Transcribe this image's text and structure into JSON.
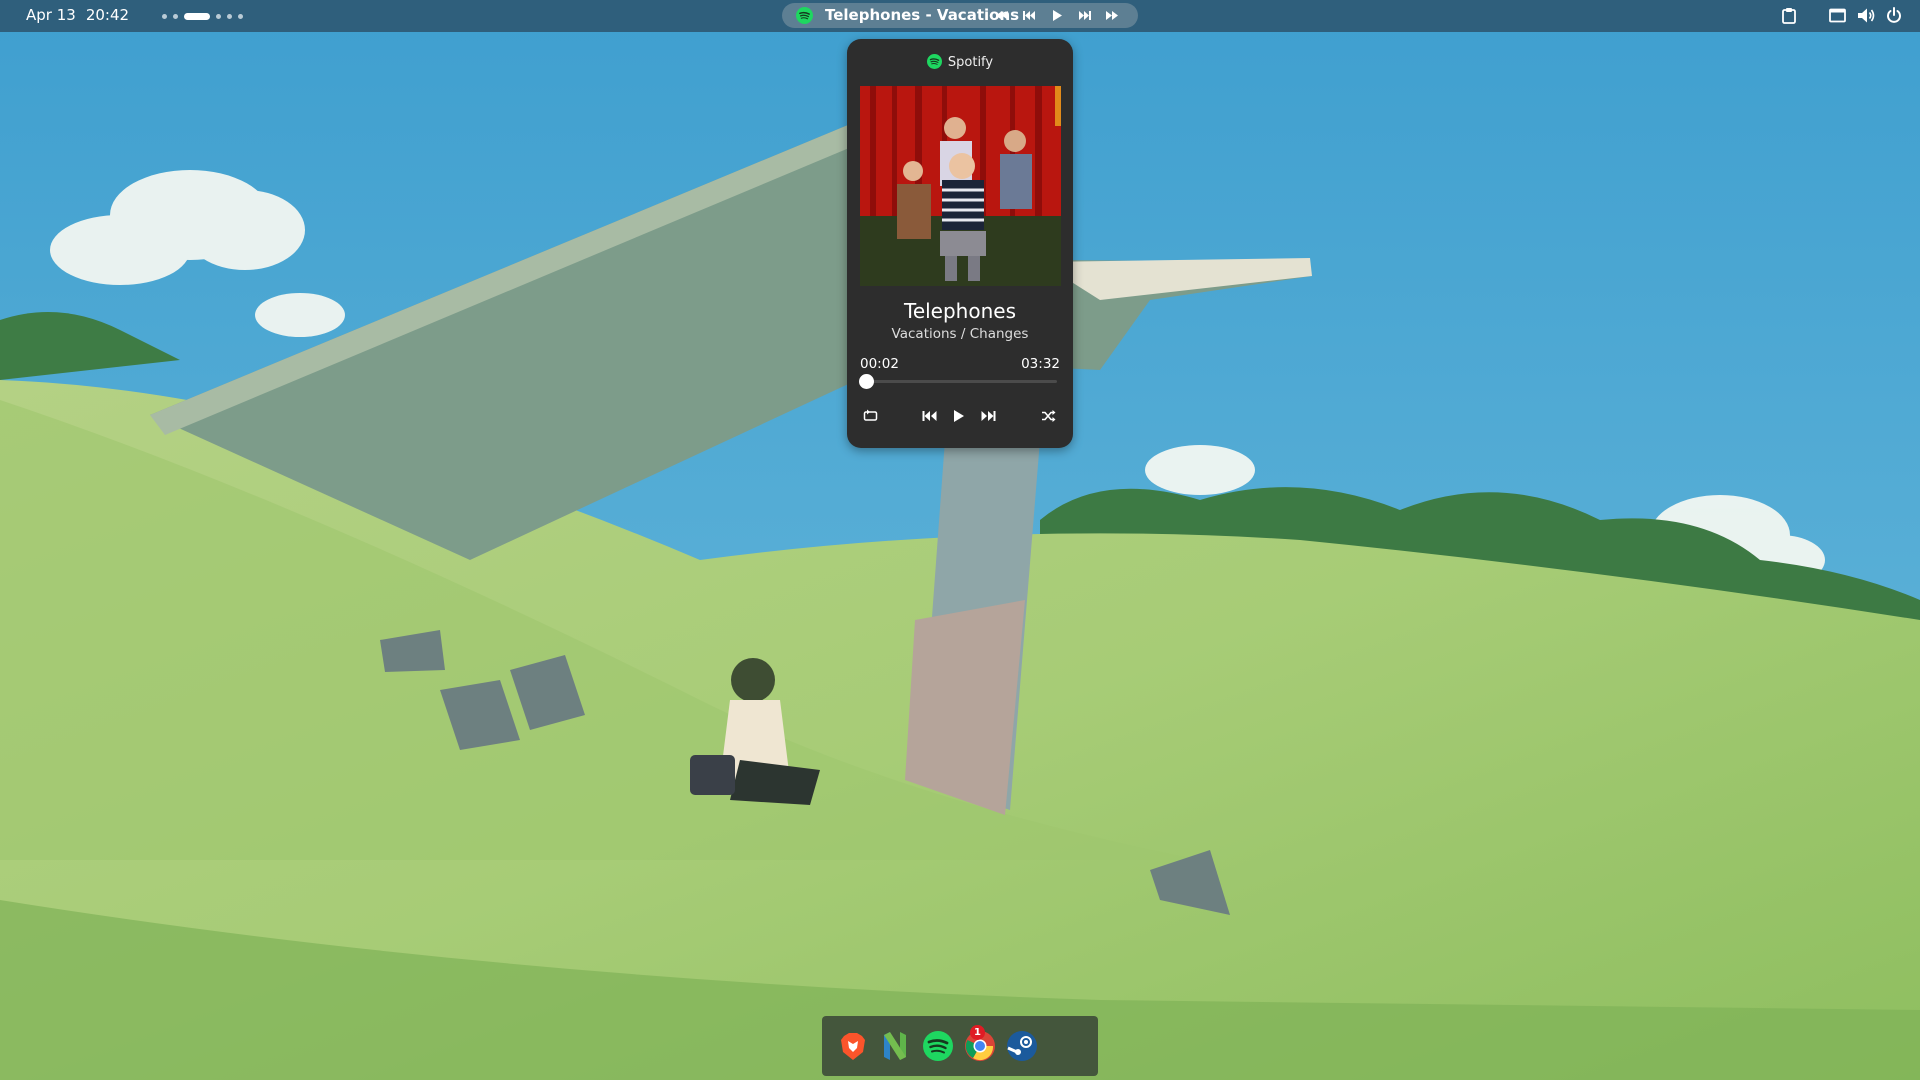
{
  "topbar": {
    "date": "Apr 13",
    "time": "20:42",
    "active_workspace": 3,
    "workspace_count": 6,
    "media_track": "Telephones - Vacations"
  },
  "popup": {
    "app_name": "Spotify",
    "title": "Telephones",
    "album": "Vacations / Changes",
    "current_time": "00:02",
    "total_time": "03:32",
    "progress_fraction": 0.01
  },
  "dock": {
    "apps": [
      "Brave",
      "Neovim",
      "Spotify",
      "Google Chrome",
      "Steam"
    ],
    "spotify_badge": "1"
  },
  "colors": {
    "topbar_bg": "#2f5f7c",
    "popup_bg": "#2d2d2d",
    "spotify_green": "#1ed760",
    "badge_red": "#e01b24"
  }
}
